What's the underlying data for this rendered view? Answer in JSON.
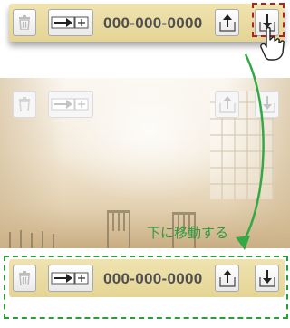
{
  "top_toolbar": {
    "number": "000-000-0000",
    "buttons": [
      "trash-icon",
      "add-contact-icon",
      "move-up-icon",
      "move-down-icon"
    ]
  },
  "middle_toolbar": {
    "buttons": [
      "trash-icon",
      "add-contact-icon",
      "move-up-icon",
      "move-down-icon"
    ]
  },
  "caption": "下に移動する",
  "bottom_toolbar": {
    "number": "000-000-0000",
    "buttons": [
      "trash-icon",
      "add-contact-icon",
      "move-up-icon",
      "move-down-icon"
    ]
  },
  "colors": {
    "toolbar_bg": "#e8d9a0",
    "caption_green": "#2e9c3f",
    "highlight_red": "#b02222",
    "highlight_green": "#2f9c3c"
  }
}
